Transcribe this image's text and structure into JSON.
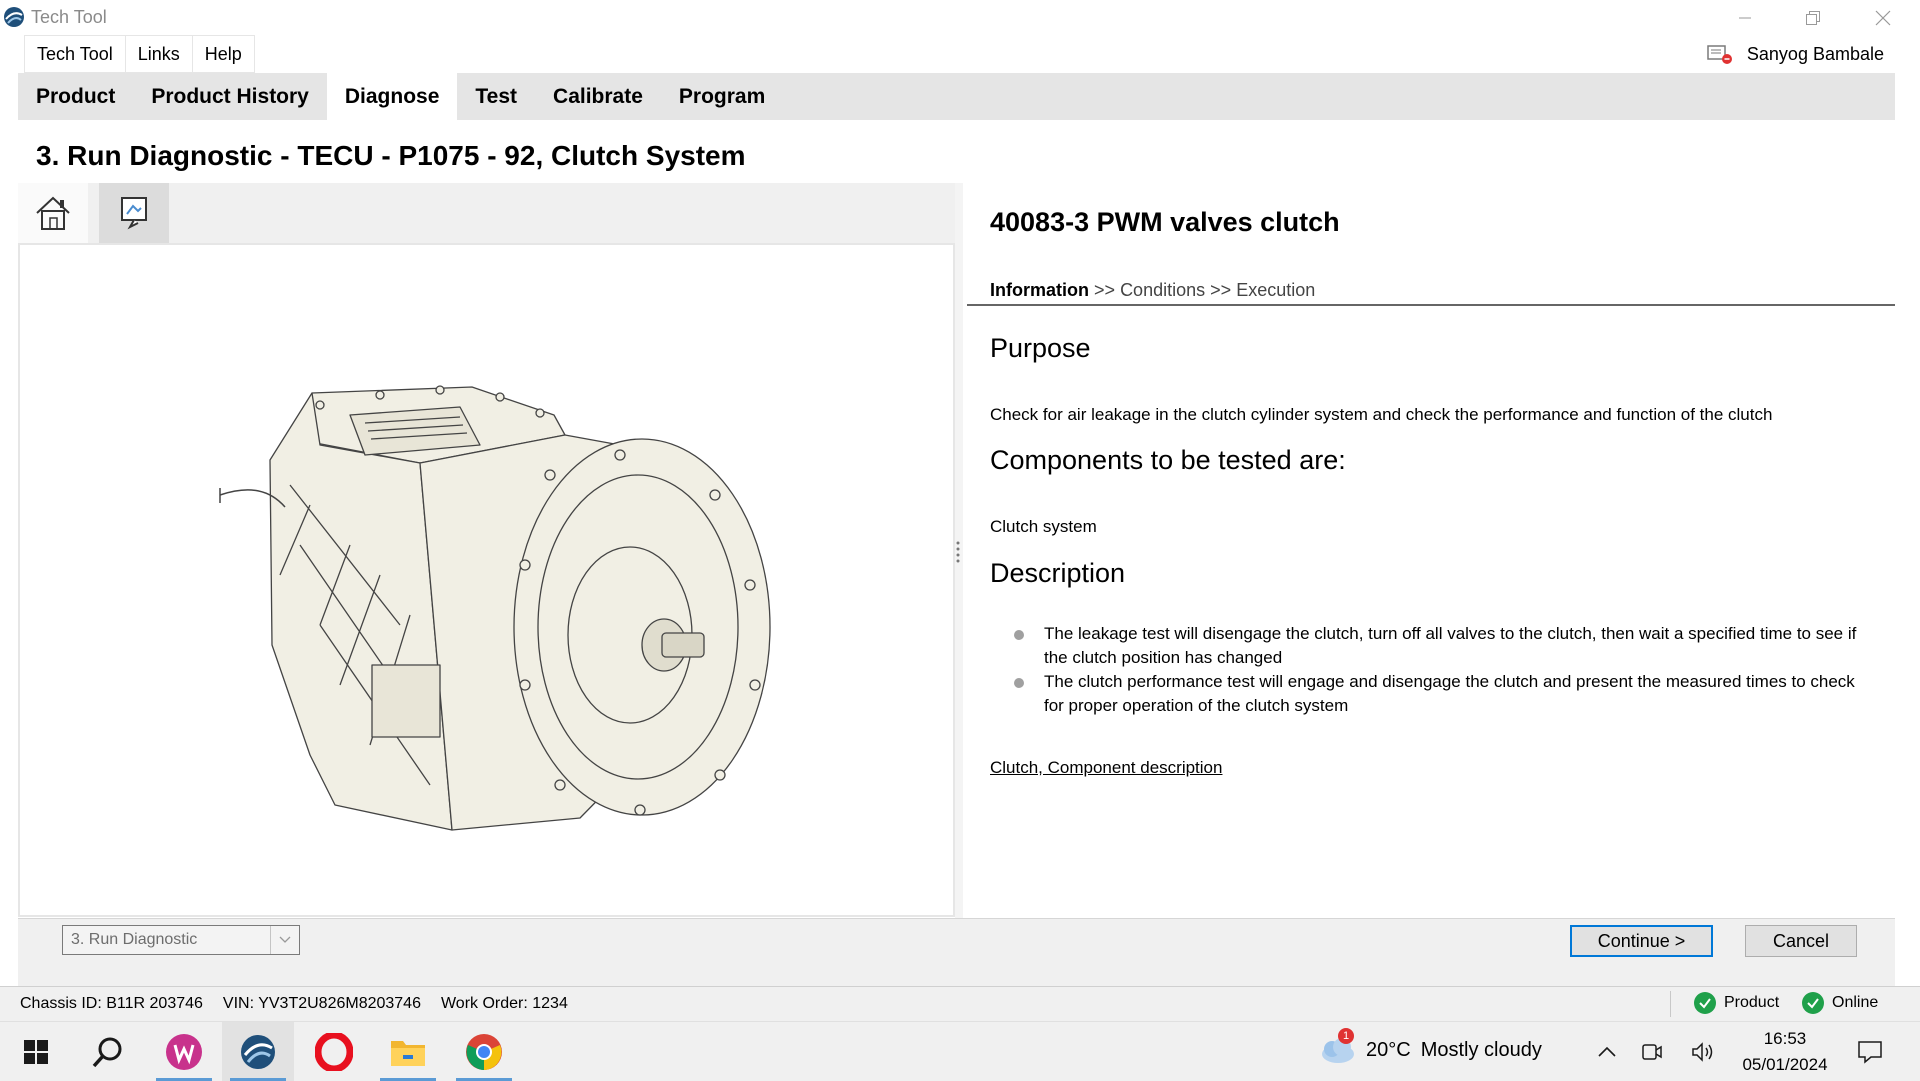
{
  "window": {
    "title": "Tech Tool"
  },
  "menu": {
    "items": [
      "Tech Tool",
      "Links",
      "Help"
    ]
  },
  "user": {
    "name": "Sanyog Bambale"
  },
  "nav": {
    "tabs": [
      "Product",
      "Product History",
      "Diagnose",
      "Test",
      "Calibrate",
      "Program"
    ],
    "active": "Diagnose"
  },
  "page": {
    "title": "3. Run Diagnostic - TECU - P1075 - 92, Clutch System"
  },
  "test": {
    "title": "40083-3 PWM valves clutch",
    "breadcrumb": {
      "current": "Information",
      "sep": ">>",
      "step2": "Conditions",
      "step3": "Execution"
    },
    "purpose_heading": "Purpose",
    "purpose_text": "Check for air leakage in the clutch cylinder system and check the performance and function of the clutch",
    "components_heading": "Components to be tested are:",
    "components_text": "Clutch system",
    "description_heading": "Description",
    "description_bullets": [
      "The leakage test will disengage the clutch, turn off all valves to the clutch, then wait a specified time to see if the clutch position has changed",
      "The clutch performance test will engage and disengage the clutch and present the measured times to check for proper operation of the clutch system"
    ],
    "link": "Clutch, Component description"
  },
  "bottom": {
    "step_select": "3. Run Diagnostic",
    "continue_label": "Continue >",
    "cancel_label": "Cancel"
  },
  "status": {
    "chassis": "Chassis ID: B11R 203746",
    "vin": "VIN: YV3T2U826M8203746",
    "work_order": "Work Order: 1234",
    "product": "Product",
    "online": "Online"
  },
  "taskbar": {
    "weather_temp": "20°C",
    "weather_text": "Mostly cloudy",
    "weather_badge": "1",
    "time": "16:53",
    "date": "05/01/2024"
  },
  "colors": {
    "accent": "#0078d7",
    "ok_green": "#1fa04a",
    "tab_bar": "#e5e5e5"
  }
}
